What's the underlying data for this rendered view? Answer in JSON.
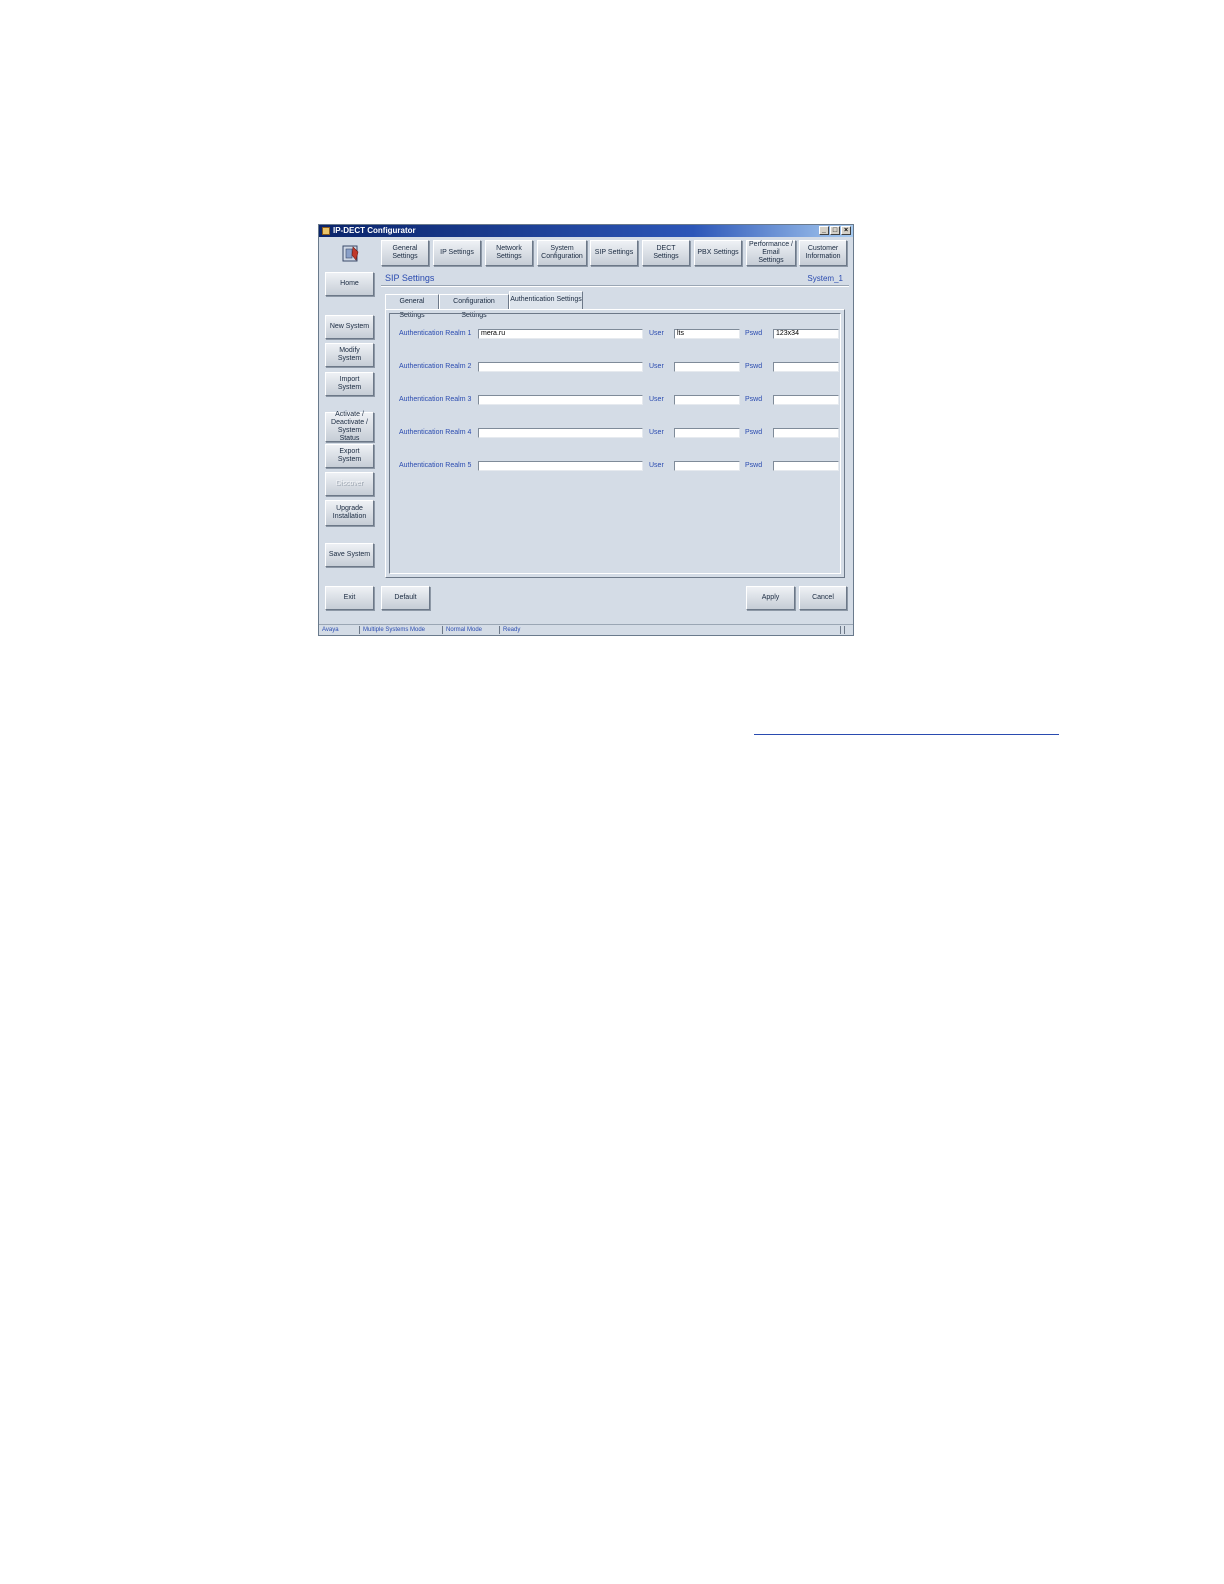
{
  "window": {
    "title": "IP-DECT Configurator",
    "controls": [
      "_",
      "□",
      "×"
    ]
  },
  "top_buttons": [
    "General\nSettings",
    "IP Settings",
    "Network\nSettings",
    "System\nConfiguration",
    "SIP Settings",
    "DECT Settings",
    "PBX Settings",
    "Performance /\nEmail Settings",
    "Customer\nInformation"
  ],
  "sidebar": {
    "home": "Home",
    "new_system": "New System",
    "modify_system": "Modify System",
    "import_system": "Import System",
    "activate": "Activate /\nDeactivate /\nSystem Status",
    "export_system": "Export System",
    "disabled_item": "Discover",
    "upgrade": "Upgrade\nInstallation",
    "save_system": "Save System",
    "exit": "Exit"
  },
  "panel": {
    "title": "SIP Settings",
    "system_name": "System_1",
    "tabs": [
      "General Settings",
      "Configuration Settings",
      "Authentication Settings"
    ],
    "active_tab": "Authentication Settings"
  },
  "realms": [
    {
      "label": "Authentication Realm 1",
      "realm": "mera.ru",
      "user_label": "User",
      "user": "lts",
      "pswd_label": "Pswd",
      "pswd": "123x34"
    },
    {
      "label": "Authentication Realm 2",
      "realm": "",
      "user_label": "User",
      "user": "",
      "pswd_label": "Pswd",
      "pswd": ""
    },
    {
      "label": "Authentication Realm 3",
      "realm": "",
      "user_label": "User",
      "user": "",
      "pswd_label": "Pswd",
      "pswd": ""
    },
    {
      "label": "Authentication Realm 4",
      "realm": "",
      "user_label": "User",
      "user": "",
      "pswd_label": "Pswd",
      "pswd": ""
    },
    {
      "label": "Authentication Realm 5",
      "realm": "",
      "user_label": "User",
      "user": "",
      "pswd_label": "Pswd",
      "pswd": ""
    }
  ],
  "footer": {
    "default": "Default",
    "apply": "Apply",
    "cancel": "Cancel"
  },
  "status_bar": [
    "Avaya",
    "Multiple Systems Mode",
    "Normal Mode",
    "Ready"
  ],
  "colors": {
    "window_bg": "#d4dce6",
    "label_blue": "#2a4bb0",
    "title_bar": "#0a246a"
  }
}
